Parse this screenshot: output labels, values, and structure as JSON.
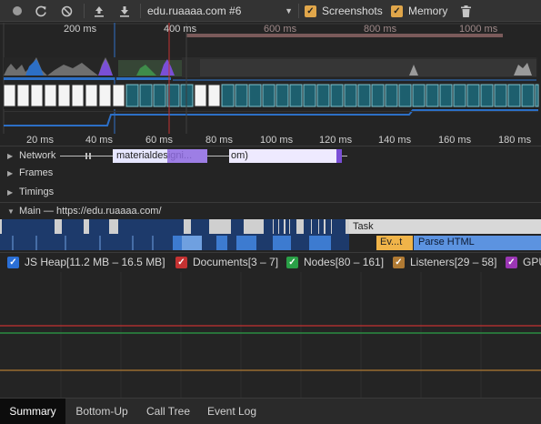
{
  "toolbar": {
    "record_icon": "record-icon",
    "reload_icon": "reload-icon",
    "clear_icon": "clear-icon",
    "upload_icon": "upload-icon",
    "download_icon": "download-icon",
    "profile_select": "edu.ruaaaa.com #6",
    "screenshots_label": "Screenshots",
    "screenshots_checked": true,
    "memory_label": "Memory",
    "memory_checked": true,
    "trash_icon": "trash-icon"
  },
  "overview": {
    "ticks": [
      "200 ms",
      "400 ms",
      "600 ms",
      "800 ms",
      "1000 ms"
    ]
  },
  "ruler": {
    "ticks": [
      "20 ms",
      "40 ms",
      "60 ms",
      "80 ms",
      "100 ms",
      "120 ms",
      "140 ms",
      "160 ms",
      "180 ms"
    ]
  },
  "tracks": {
    "network": "Network",
    "network_item1": "materialdesigni...",
    "network_item2": "om)",
    "frames": "Frames",
    "timings": "Timings",
    "main": "Main — https://edu.ruaaaa.com/",
    "task": "Task",
    "event": "Ev...t",
    "parse_html": "Parse HTML"
  },
  "legend": {
    "js_heap": "JS Heap[11.2 MB – 16.5 MB]",
    "documents": "Documents[3 – 7]",
    "nodes": "Nodes[80 – 161]",
    "listeners": "Listeners[29 – 58]",
    "gpu": "GPU"
  },
  "colors": {
    "js_heap": "#2a6fd6",
    "documents": "#c43232",
    "nodes": "#2aa047",
    "listeners": "#b07a33",
    "gpu": "#9b36b4",
    "checkbox": "#e0a64a"
  },
  "bottom_tabs": [
    "Summary",
    "Bottom-Up",
    "Call Tree",
    "Event Log"
  ]
}
